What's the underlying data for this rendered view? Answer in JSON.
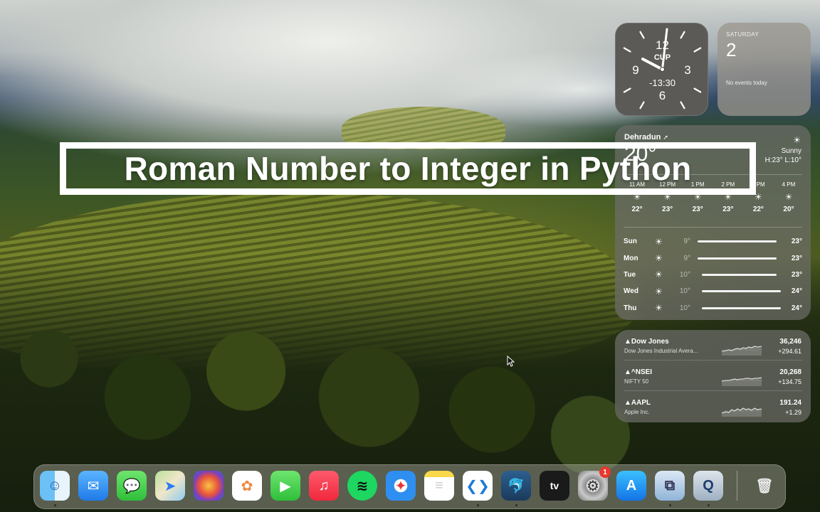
{
  "title": "Roman Number to Integer in Python",
  "clock": {
    "numerals": [
      "12",
      "3",
      "6",
      "9"
    ],
    "city_code": "CUP",
    "offset": "-13:30"
  },
  "calendar": {
    "day": "SATURDAY",
    "date": "2",
    "events": "No events today"
  },
  "weather": {
    "city": "Dehradun",
    "location_icon": "location-arrow-icon",
    "temp": "20°",
    "condition": "Sunny",
    "high_low": "H:23° L:10°",
    "hourly": [
      {
        "time": "11 AM",
        "temp": "22°"
      },
      {
        "time": "12 PM",
        "temp": "23°"
      },
      {
        "time": "1 PM",
        "temp": "23°"
      },
      {
        "time": "2 PM",
        "temp": "23°"
      },
      {
        "time": "3 PM",
        "temp": "22°"
      },
      {
        "time": "4 PM",
        "temp": "20°"
      }
    ],
    "daily": [
      {
        "day": "Sun",
        "low": "9°",
        "high": "23°",
        "low_val": 9,
        "high_val": 23
      },
      {
        "day": "Mon",
        "low": "9°",
        "high": "23°",
        "low_val": 9,
        "high_val": 23
      },
      {
        "day": "Tue",
        "low": "10°",
        "high": "23°",
        "low_val": 10,
        "high_val": 23
      },
      {
        "day": "Wed",
        "low": "10°",
        "high": "24°",
        "low_val": 10,
        "high_val": 24
      },
      {
        "day": "Thu",
        "low": "10°",
        "high": "24°",
        "low_val": 10,
        "high_val": 24
      }
    ]
  },
  "stocks": [
    {
      "symbol": "▲Dow Jones",
      "name": "Dow Jones Industrial Avera...",
      "value": "36,246",
      "change": "+294.61"
    },
    {
      "symbol": "▲^NSEI",
      "name": "NIFTY 50",
      "value": "20,268",
      "change": "+134.75"
    },
    {
      "symbol": "▲AAPL",
      "name": "Apple Inc.",
      "value": "191.24",
      "change": "+1.29"
    }
  ],
  "dock": {
    "apps": [
      {
        "name": "finder-icon",
        "running": true
      },
      {
        "name": "mail-icon",
        "running": false
      },
      {
        "name": "messages-icon",
        "running": false
      },
      {
        "name": "maps-icon",
        "running": false
      },
      {
        "name": "color-picker-icon",
        "running": false
      },
      {
        "name": "photos-icon",
        "running": false
      },
      {
        "name": "facetime-icon",
        "running": false
      },
      {
        "name": "music-icon",
        "running": false
      },
      {
        "name": "spotify-icon",
        "running": false
      },
      {
        "name": "safari-icon",
        "running": false
      },
      {
        "name": "notes-icon",
        "running": false
      },
      {
        "name": "vscode-icon",
        "running": true
      },
      {
        "name": "mysql-workbench-icon",
        "running": true
      },
      {
        "name": "apple-tv-icon",
        "running": false
      },
      {
        "name": "system-settings-icon",
        "running": false,
        "badge": "1"
      },
      {
        "name": "app-store-icon",
        "running": false
      },
      {
        "name": "preview-icon",
        "running": true
      },
      {
        "name": "quicktime-icon",
        "running": true
      },
      {
        "name": "trash-icon",
        "running": false
      }
    ],
    "apple_tv_label": "tv"
  }
}
